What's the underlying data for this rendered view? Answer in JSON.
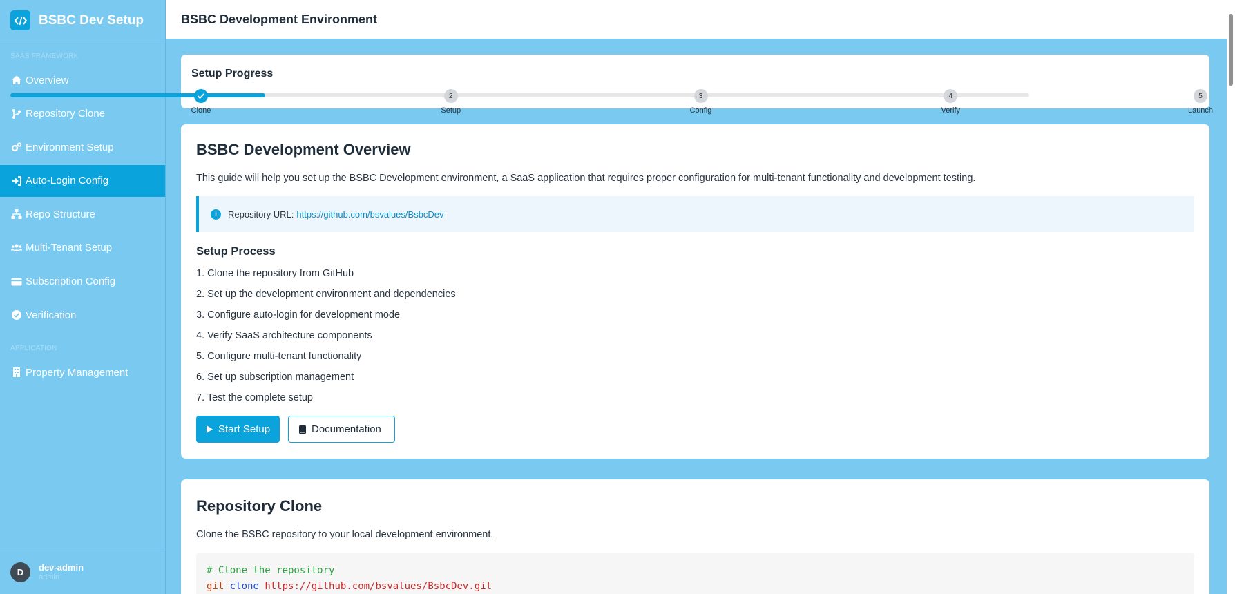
{
  "app": {
    "title": "BSBC Dev Setup"
  },
  "sidebar": {
    "sections": [
      {
        "label": "SAAS FRAMEWORK",
        "items": [
          {
            "label": "Overview",
            "icon": "home-icon"
          },
          {
            "label": "Repository Clone",
            "icon": "code-branch-icon"
          },
          {
            "label": "Environment Setup",
            "icon": "cogs-icon"
          },
          {
            "label": "Auto-Login Config",
            "icon": "sign-in-icon",
            "active": true
          },
          {
            "label": "Repo Structure",
            "icon": "sitemap-icon"
          },
          {
            "label": "Multi-Tenant Setup",
            "icon": "users-icon"
          },
          {
            "label": "Subscription Config",
            "icon": "credit-card-icon"
          },
          {
            "label": "Verification",
            "icon": "check-circle-icon"
          }
        ]
      },
      {
        "label": "APPLICATION",
        "items": [
          {
            "label": "Property Management",
            "icon": "building-icon"
          }
        ]
      }
    ],
    "user": {
      "initial": "D",
      "name": "dev-admin",
      "role": "admin"
    }
  },
  "header": {
    "title": "BSBC Development Environment"
  },
  "progress": {
    "title": "Setup Progress",
    "fraction": 0.25,
    "steps": [
      {
        "number": "1",
        "label": "Clone",
        "done": true
      },
      {
        "number": "2",
        "label": "Setup",
        "done": false
      },
      {
        "number": "3",
        "label": "Config",
        "done": false
      },
      {
        "number": "4",
        "label": "Verify",
        "done": false
      },
      {
        "number": "5",
        "label": "Launch",
        "done": false
      }
    ]
  },
  "overview": {
    "title": "BSBC Development Overview",
    "description": "This guide will help you set up the BSBC Development environment, a SaaS application that requires proper configuration for multi-tenant functionality and development testing.",
    "repo_label": "Repository URL:",
    "repo_url": "https://github.com/bsvalues/BsbcDev",
    "process_title": "Setup Process",
    "steps": [
      "1. Clone the repository from GitHub",
      "2. Set up the development environment and dependencies",
      "3. Configure auto-login for development mode",
      "4. Verify SaaS architecture components",
      "5. Configure multi-tenant functionality",
      "6. Set up subscription management",
      "7. Test the complete setup"
    ],
    "start_button": "Start Setup",
    "docs_button": "Documentation"
  },
  "repo_clone": {
    "title": "Repository Clone",
    "description": "Clone the BSBC repository to your local development environment.",
    "code": {
      "comment": "# Clone the repository",
      "cmd": "git",
      "sub": "clone",
      "url": "https://github.com/bsvalues/BsbcDev.git"
    }
  },
  "colors": {
    "accent": "#0aa3dc",
    "sidebar_bg": "#79c9f0",
    "page_bg": "#79c9f0"
  }
}
